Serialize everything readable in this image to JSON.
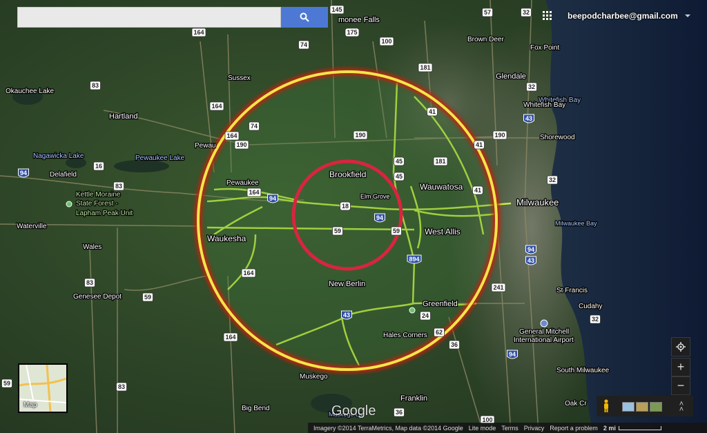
{
  "search": {
    "placeholder": "",
    "button_icon": "search-icon"
  },
  "account": {
    "email": "beepodcharbee@gmail.com"
  },
  "map": {
    "places": [
      {
        "id": "menomonee-falls",
        "name": "monee Falls"
      },
      {
        "id": "brown-deer",
        "name": "Brown Deer"
      },
      {
        "id": "fox-point",
        "name": "Fox Point"
      },
      {
        "id": "okauchee-lake",
        "name": "Okauchee Lake"
      },
      {
        "id": "sussex",
        "name": "Sussex"
      },
      {
        "id": "glendale",
        "name": "Glendale"
      },
      {
        "id": "whitefish-bay-water",
        "name": "Whitefish Bay"
      },
      {
        "id": "whitefish-bay",
        "name": "Whitefish Bay"
      },
      {
        "id": "hartland",
        "name": "Hartland"
      },
      {
        "id": "shorewood",
        "name": "Shorewood"
      },
      {
        "id": "pewaukee-town",
        "name": "Pewau"
      },
      {
        "id": "nagawicka-lake",
        "name": "Nagawicka Lake"
      },
      {
        "id": "pewaukee-lake",
        "name": "Pewaukee Lake"
      },
      {
        "id": "delafield",
        "name": "Delafield"
      },
      {
        "id": "brookfield",
        "name": "Brookfield"
      },
      {
        "id": "wauwatosa",
        "name": "Wauwatosa"
      },
      {
        "id": "pewaukee",
        "name": "Pewaukee"
      },
      {
        "id": "elm-grove",
        "name": "Elm Grove"
      },
      {
        "id": "kettle-moraine",
        "name": "Kettle Moraine"
      },
      {
        "id": "state-forest",
        "name": "State Forest -"
      },
      {
        "id": "lapham-peak",
        "name": "Lapham Peak Unit"
      },
      {
        "id": "milwaukee",
        "name": "Milwaukee"
      },
      {
        "id": "waterville",
        "name": "Waterville"
      },
      {
        "id": "milwaukee-bay",
        "name": "Milwaukee Bay"
      },
      {
        "id": "west-allis",
        "name": "West Allis"
      },
      {
        "id": "waukesha",
        "name": "Waukesha"
      },
      {
        "id": "wales",
        "name": "Wales"
      },
      {
        "id": "new-berlin",
        "name": "New Berlin"
      },
      {
        "id": "st-francis",
        "name": "St Francis"
      },
      {
        "id": "genesee-depot",
        "name": "Genesee Depot"
      },
      {
        "id": "cudahy",
        "name": "Cudahy"
      },
      {
        "id": "greenfield",
        "name": "Greenfield"
      },
      {
        "id": "general-mitchell",
        "name": "General Mitchell"
      },
      {
        "id": "intl-airport",
        "name": "International Airport"
      },
      {
        "id": "hales-corners",
        "name": "Hales Corners"
      },
      {
        "id": "south-milwaukee",
        "name": "South Milwaukee"
      },
      {
        "id": "muskego",
        "name": "Muskego"
      },
      {
        "id": "franklin",
        "name": "Franklin"
      },
      {
        "id": "big-bend",
        "name": "Big Bend"
      },
      {
        "id": "oak-creek",
        "name": "Oak Cr"
      },
      {
        "id": "muskego-lake",
        "name": "Muskego La"
      }
    ],
    "shields": [
      {
        "id": "s164a",
        "label": "164"
      },
      {
        "id": "s175",
        "label": "175"
      },
      {
        "id": "s145",
        "label": "145"
      },
      {
        "id": "s32a",
        "label": "32"
      },
      {
        "id": "s74a",
        "label": "74"
      },
      {
        "id": "s100a",
        "label": "100"
      },
      {
        "id": "s57",
        "label": "57"
      },
      {
        "id": "s83a",
        "label": "83"
      },
      {
        "id": "s181a",
        "label": "181"
      },
      {
        "id": "s164b",
        "label": "164"
      },
      {
        "id": "s41a",
        "label": "41"
      },
      {
        "id": "s32b",
        "label": "32"
      },
      {
        "id": "s43a",
        "label": "43"
      },
      {
        "id": "s74b",
        "label": "74"
      },
      {
        "id": "s164c",
        "label": "164"
      },
      {
        "id": "s190a",
        "label": "190"
      },
      {
        "id": "s190b",
        "label": "190"
      },
      {
        "id": "s190c",
        "label": "190"
      },
      {
        "id": "s45a",
        "label": "45"
      },
      {
        "id": "s181b",
        "label": "181"
      },
      {
        "id": "s41b",
        "label": "41"
      },
      {
        "id": "s16",
        "label": "16"
      },
      {
        "id": "s83b",
        "label": "83"
      },
      {
        "id": "s94a",
        "label": "94"
      },
      {
        "id": "s45b",
        "label": "45"
      },
      {
        "id": "s164d",
        "label": "164"
      },
      {
        "id": "s94b",
        "label": "94"
      },
      {
        "id": "s41c",
        "label": "41"
      },
      {
        "id": "s18",
        "label": "18"
      },
      {
        "id": "s32c",
        "label": "32"
      },
      {
        "id": "s94c",
        "label": "94"
      },
      {
        "id": "s59a",
        "label": "59"
      },
      {
        "id": "s59b",
        "label": "59"
      },
      {
        "id": "s894",
        "label": "894"
      },
      {
        "id": "s94d",
        "label": "94"
      },
      {
        "id": "s43b",
        "label": "43"
      },
      {
        "id": "s164e",
        "label": "164"
      },
      {
        "id": "s83c",
        "label": "83"
      },
      {
        "id": "s241",
        "label": "241"
      },
      {
        "id": "s59c",
        "label": "59"
      },
      {
        "id": "s32d",
        "label": "32"
      },
      {
        "id": "s43c",
        "label": "43"
      },
      {
        "id": "s24",
        "label": "24"
      },
      {
        "id": "s62",
        "label": "62"
      },
      {
        "id": "s164f",
        "label": "164"
      },
      {
        "id": "s36a",
        "label": "36"
      },
      {
        "id": "s94e",
        "label": "94"
      },
      {
        "id": "s83d",
        "label": "83"
      },
      {
        "id": "s36b",
        "label": "36"
      },
      {
        "id": "s100b",
        "label": "100"
      },
      {
        "id": "s59d",
        "label": "59"
      }
    ],
    "watermark": "Google",
    "thumbnail_label": "Map"
  },
  "controls": {
    "locate_icon": "crosshair-icon",
    "zoom_in": "+",
    "zoom_out": "−",
    "pegman_icon": "pegman-icon",
    "expand_icon": "chevron-up-icon"
  },
  "footer": {
    "attribution": "Imagery ©2014 TerraMetrics, Map data ©2014 Google",
    "lite_mode": "Lite mode",
    "terms": "Terms",
    "privacy": "Privacy",
    "report": "Report a problem",
    "scale": "2 mi"
  },
  "colors": {
    "outer_ring": "#f2e64a",
    "outer_ring_glow": "#c0200f",
    "inner_ring": "#d8253f",
    "road_highlight": "#c7f041",
    "search_button": "#4d79d4"
  }
}
